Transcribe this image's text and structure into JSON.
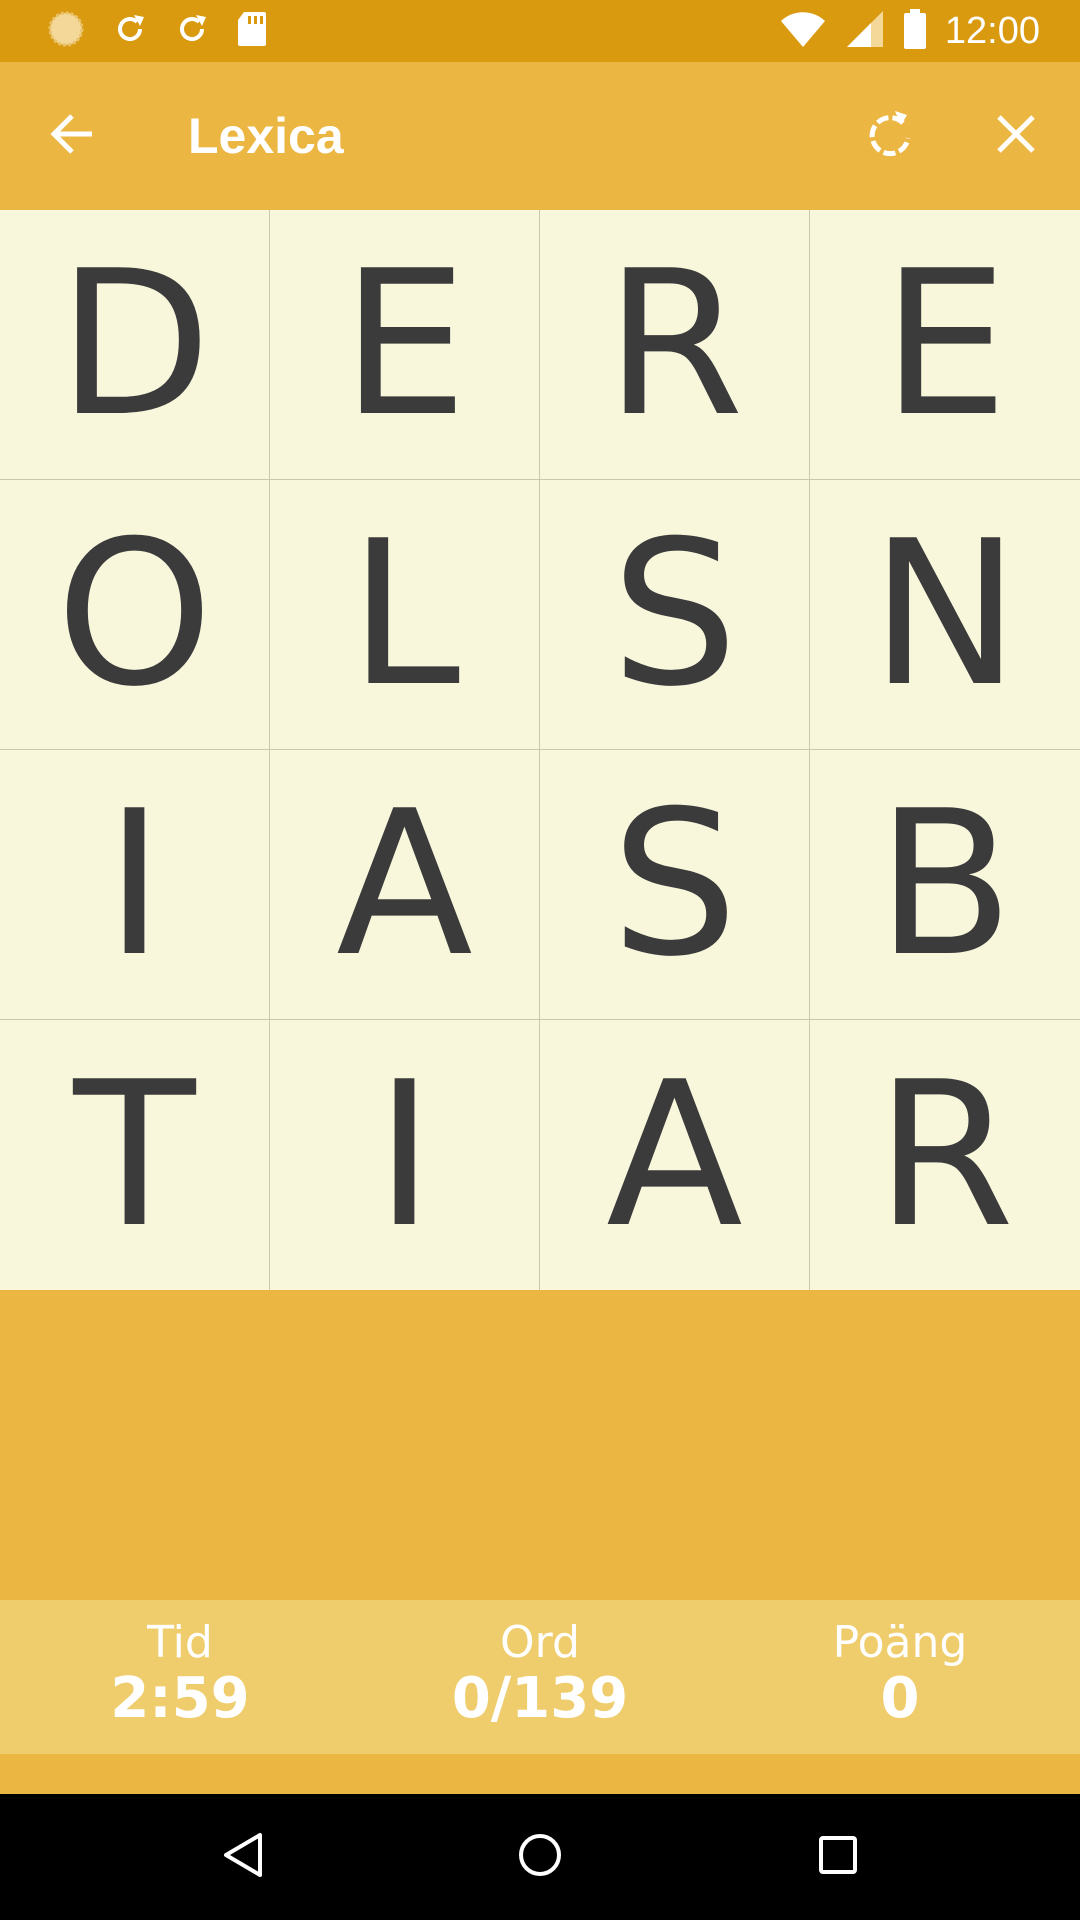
{
  "status_bar": {
    "time": "12:00",
    "icons": [
      "loading-circle-icon",
      "sync-icon",
      "sync-icon",
      "sd-card-icon",
      "wifi-icon",
      "signal-icon",
      "battery-icon"
    ]
  },
  "app_bar": {
    "title": "Lexica",
    "icons": [
      "back-arrow-icon",
      "refresh-icon",
      "close-icon"
    ]
  },
  "board": {
    "rows": [
      [
        "D",
        "E",
        "R",
        "E"
      ],
      [
        "O",
        "L",
        "S",
        "N"
      ],
      [
        "I",
        "A",
        "S",
        "B"
      ],
      [
        "T",
        "I",
        "A",
        "R"
      ]
    ]
  },
  "stats": {
    "time": {
      "label": "Tid",
      "value": "2:59"
    },
    "words": {
      "label": "Ord",
      "value": "0/139"
    },
    "score": {
      "label": "Poäng",
      "value": "0"
    }
  },
  "colors": {
    "status_bar": "#D99A10",
    "app_bar": "#ECB642",
    "board_background": "#F8F7DC",
    "letter": "#3B3B3B",
    "score_bar": "#EFCC6C",
    "nav_bar": "#000000"
  },
  "nav_bar": {
    "icons": [
      "back-triangle-icon",
      "home-circle-icon",
      "recents-square-icon"
    ]
  }
}
